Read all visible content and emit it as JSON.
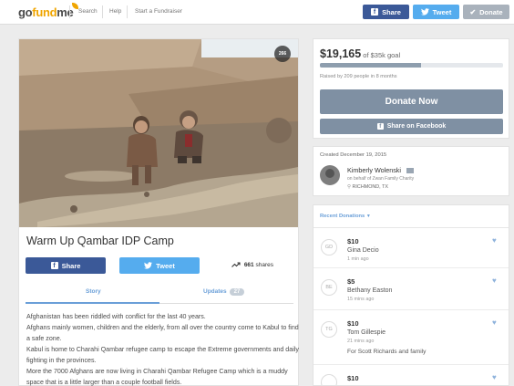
{
  "topbar": {
    "logo_go": "go",
    "logo_fund": "fund",
    "logo_me": "me",
    "nav": [
      "Search",
      "Help",
      "Start a Fundraiser"
    ],
    "share_label": "Share",
    "tweet_label": "Tweet",
    "donate_label": "Donate",
    "facebook_icon": "f",
    "twitter_icon": "bird",
    "donate_icon": "check"
  },
  "campaign": {
    "heart_count": "266",
    "title": "Warm Up Qambar IDP Camp",
    "share_label": "Share",
    "tweet_label": "Tweet",
    "shares_count": "661",
    "shares_label": "shares",
    "tabs": {
      "story": "Story",
      "updates": "Updates",
      "updates_count": "27"
    },
    "story": [
      "Afghanistan has been riddled with conflict for the last 40 years.",
      "Afghans mainly women, children and the elderly, from all over the country come to Kabul to find a safe zone.",
      "Kabul is home to Charahi Qambar refugee camp to escape the Extreme governments and daily fighting in the provinces.",
      "More the 7000 Afghans are now living in Charahi Qambar Refugee Camp which is a muddy space that is a little larger than a couple football fields."
    ]
  },
  "donate_box": {
    "amount": "$19,165",
    "goal_text": "of $35k goal",
    "progress": 0.55,
    "raised_by": "Raised by 209 people in 8 months",
    "donate_now": "Donate Now",
    "share_facebook": "Share on Facebook"
  },
  "organizer": {
    "created": "Created December 19, 2015",
    "name": "Kimberly Wolenski",
    "behalf": "on behalf of Zwan Family Charity",
    "location": "RICHMOND, TX"
  },
  "donations": {
    "header": "Recent Donations",
    "items": [
      {
        "initials": "GD",
        "amount": "$10",
        "name": "Gina Decio",
        "time": "1 min ago",
        "message": ""
      },
      {
        "initials": "BE",
        "amount": "$5",
        "name": "Bethany Easton",
        "time": "15 mins ago",
        "message": ""
      },
      {
        "initials": "TG",
        "amount": "$10",
        "name": "Tom Gillespie",
        "time": "21 mins ago",
        "message": "For Scott Richards and family"
      },
      {
        "initials": "",
        "amount": "$10",
        "name": "",
        "time": "",
        "message": ""
      }
    ]
  },
  "colors": {
    "facebook": "#3b5998",
    "twitter": "#55acee",
    "accent": "#6a9fd8",
    "donate_button": "#7f90a3",
    "logo_orange": "#f0a500"
  }
}
